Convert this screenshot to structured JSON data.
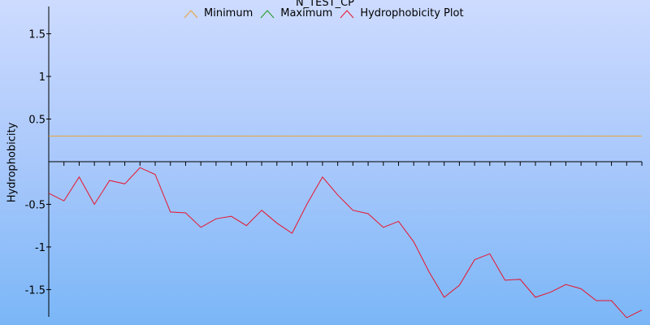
{
  "chart_data": {
    "type": "line",
    "title": "N_TEST_CP",
    "xlabel": "",
    "ylabel": "Hydrophobicity",
    "ylim": [
      -1.82,
      1.82
    ],
    "yticks": [
      1.5,
      1,
      0.5,
      -0.5,
      -1,
      -1.5
    ],
    "ytick_labels": [
      "1.5",
      "1",
      "0.5",
      "-0.5",
      "-1",
      "-1.5"
    ],
    "x_count": 40,
    "legend_position": "top",
    "grid": false,
    "series": [
      {
        "name": "Minimum",
        "color": "#e8a33c",
        "values": [
          0.3,
          0.3,
          0.3,
          0.3,
          0.3,
          0.3,
          0.3,
          0.3,
          0.3,
          0.3,
          0.3,
          0.3,
          0.3,
          0.3,
          0.3,
          0.3,
          0.3,
          0.3,
          0.3,
          0.3,
          0.3,
          0.3,
          0.3,
          0.3,
          0.3,
          0.3,
          0.3,
          0.3,
          0.3,
          0.3,
          0.3,
          0.3,
          0.3,
          0.3,
          0.3,
          0.3,
          0.3,
          0.3,
          0.3,
          0.3
        ]
      },
      {
        "name": "Maximum",
        "color": "#1e9a1e",
        "values": []
      },
      {
        "name": "Hydrophobicity Plot",
        "color": "#e8142c",
        "values": [
          -0.37,
          -0.46,
          -0.18,
          -0.5,
          -0.22,
          -0.26,
          -0.07,
          -0.15,
          -0.59,
          -0.6,
          -0.77,
          -0.67,
          -0.64,
          -0.75,
          -0.57,
          -0.72,
          -0.84,
          -0.49,
          -0.18,
          -0.39,
          -0.57,
          -0.61,
          -0.77,
          -0.7,
          -0.94,
          -1.29,
          -1.59,
          -1.45,
          -1.15,
          -1.08,
          -1.39,
          -1.38,
          -1.59,
          -1.53,
          -1.44,
          -1.49,
          -1.63,
          -1.63,
          -1.83,
          -1.74
        ]
      }
    ]
  }
}
